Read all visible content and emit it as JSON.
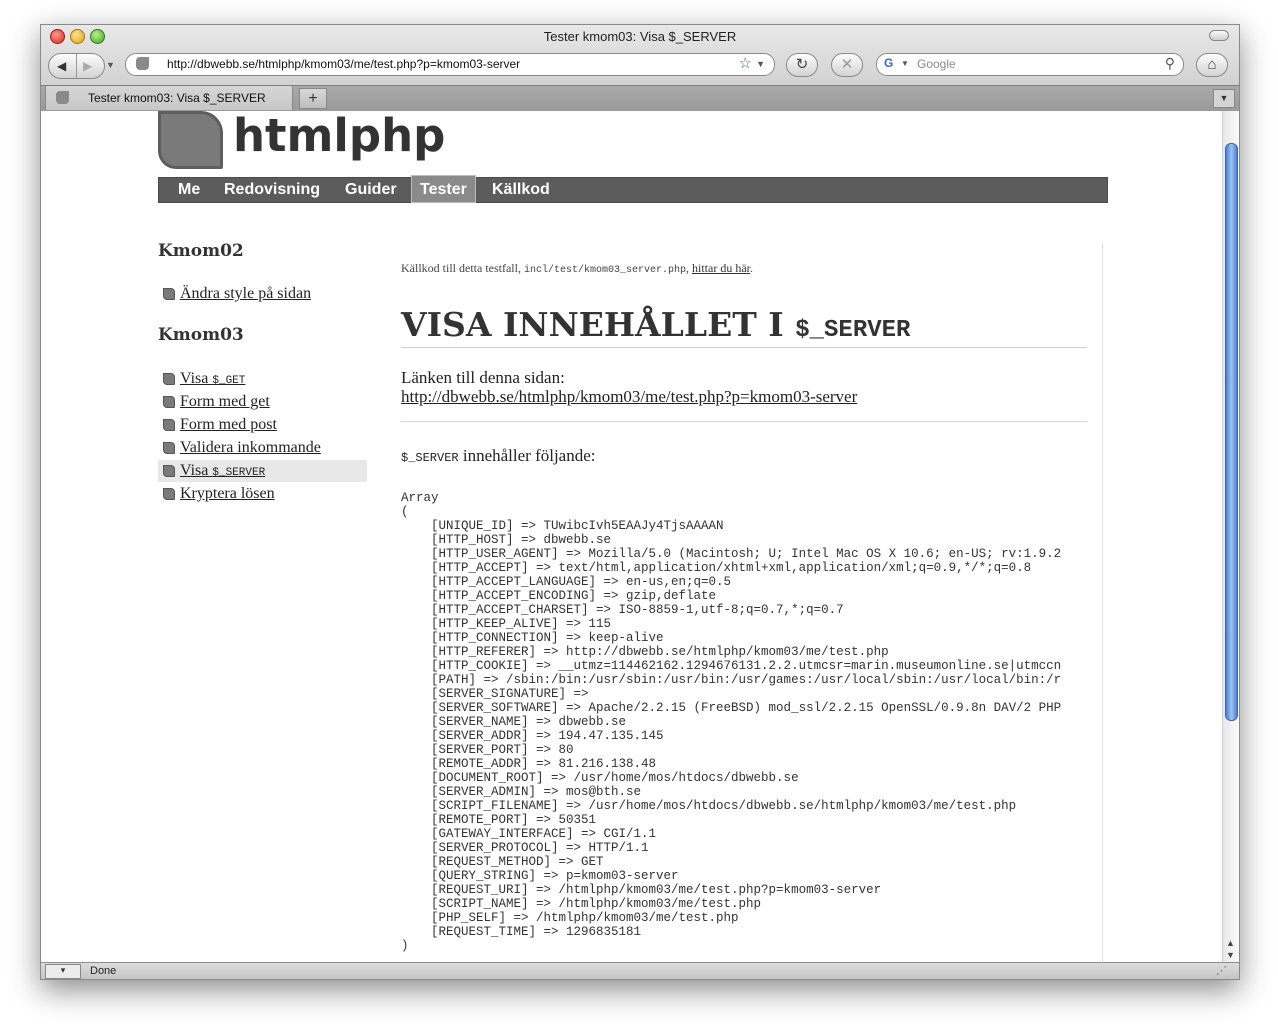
{
  "window": {
    "title": "Tester kmom03: Visa $_SERVER"
  },
  "toolbar": {
    "url": "http://dbwebb.se/htmlphp/kmom03/me/test.php?p=kmom03-server",
    "search_placeholder": "Google"
  },
  "tabs": [
    {
      "label": "Tester kmom03: Visa $_SERVER"
    }
  ],
  "status": {
    "text": "Done"
  },
  "site": {
    "logo_text": "htmlphp",
    "nav": [
      {
        "label": "Me"
      },
      {
        "label": "Redovisning"
      },
      {
        "label": "Guider"
      },
      {
        "label": "Tester"
      },
      {
        "label": "Källkod"
      }
    ]
  },
  "sidebar": {
    "kmom02": {
      "heading": "Kmom02",
      "items": [
        {
          "label": "Ändra style på sidan"
        }
      ]
    },
    "kmom03": {
      "heading": "Kmom03",
      "items": [
        {
          "label": "Visa ",
          "code": "$_GET"
        },
        {
          "label": "Form med get"
        },
        {
          "label": "Form med post"
        },
        {
          "label": "Validera inkommande"
        },
        {
          "label": "Visa ",
          "code": "$_SERVER"
        },
        {
          "label": "Kryptera lösen"
        }
      ]
    }
  },
  "content": {
    "source_prefix": "Källkod till detta testfall, ",
    "source_file": "incl/test/kmom03_server.php",
    "source_sep": ", ",
    "source_link": "hittar du här",
    "source_suffix": ".",
    "heading_text": "VISA INNEHÅLLET I ",
    "heading_code": "$_SERVER",
    "link_label": "Länken till denna sidan:",
    "link_url": "http://dbwebb.se/htmlphp/kmom03/me/test.php?p=kmom03-server",
    "contains_code": "$_SERVER",
    "contains_text": " innehåller följande:",
    "array_open": "Array",
    "paren_open": "(",
    "paren_close": ")",
    "server_vars": [
      {
        "key": "UNIQUE_ID",
        "value": "TUwibcIvh5EAAJy4TjsAAAAN"
      },
      {
        "key": "HTTP_HOST",
        "value": "dbwebb.se"
      },
      {
        "key": "HTTP_USER_AGENT",
        "value": "Mozilla/5.0 (Macintosh; U; Intel Mac OS X 10.6; en-US; rv:1.9.2"
      },
      {
        "key": "HTTP_ACCEPT",
        "value": "text/html,application/xhtml+xml,application/xml;q=0.9,*/*;q=0.8"
      },
      {
        "key": "HTTP_ACCEPT_LANGUAGE",
        "value": "en-us,en;q=0.5"
      },
      {
        "key": "HTTP_ACCEPT_ENCODING",
        "value": "gzip,deflate"
      },
      {
        "key": "HTTP_ACCEPT_CHARSET",
        "value": "ISO-8859-1,utf-8;q=0.7,*;q=0.7"
      },
      {
        "key": "HTTP_KEEP_ALIVE",
        "value": "115"
      },
      {
        "key": "HTTP_CONNECTION",
        "value": "keep-alive"
      },
      {
        "key": "HTTP_REFERER",
        "value": "http://dbwebb.se/htmlphp/kmom03/me/test.php"
      },
      {
        "key": "HTTP_COOKIE",
        "value": "__utmz=114462162.1294676131.2.2.utmcsr=marin.museumonline.se|utmccn"
      },
      {
        "key": "PATH",
        "value": "/sbin:/bin:/usr/sbin:/usr/bin:/usr/games:/usr/local/sbin:/usr/local/bin:/r"
      },
      {
        "key": "SERVER_SIGNATURE",
        "value": ""
      },
      {
        "key": "SERVER_SOFTWARE",
        "value": "Apache/2.2.15 (FreeBSD) mod_ssl/2.2.15 OpenSSL/0.9.8n DAV/2 PHP"
      },
      {
        "key": "SERVER_NAME",
        "value": "dbwebb.se"
      },
      {
        "key": "SERVER_ADDR",
        "value": "194.47.135.145"
      },
      {
        "key": "SERVER_PORT",
        "value": "80"
      },
      {
        "key": "REMOTE_ADDR",
        "value": "81.216.138.48"
      },
      {
        "key": "DOCUMENT_ROOT",
        "value": "/usr/home/mos/htdocs/dbwebb.se"
      },
      {
        "key": "SERVER_ADMIN",
        "value": "mos@bth.se"
      },
      {
        "key": "SCRIPT_FILENAME",
        "value": "/usr/home/mos/htdocs/dbwebb.se/htmlphp/kmom03/me/test.php"
      },
      {
        "key": "REMOTE_PORT",
        "value": "50351"
      },
      {
        "key": "GATEWAY_INTERFACE",
        "value": "CGI/1.1"
      },
      {
        "key": "SERVER_PROTOCOL",
        "value": "HTTP/1.1"
      },
      {
        "key": "REQUEST_METHOD",
        "value": "GET"
      },
      {
        "key": "QUERY_STRING",
        "value": "p=kmom03-server"
      },
      {
        "key": "REQUEST_URI",
        "value": "/htmlphp/kmom03/me/test.php?p=kmom03-server"
      },
      {
        "key": "SCRIPT_NAME",
        "value": "/htmlphp/kmom03/me/test.php"
      },
      {
        "key": "PHP_SELF",
        "value": "/htmlphp/kmom03/me/test.php"
      },
      {
        "key": "REQUEST_TIME",
        "value": "1296835181"
      }
    ]
  }
}
